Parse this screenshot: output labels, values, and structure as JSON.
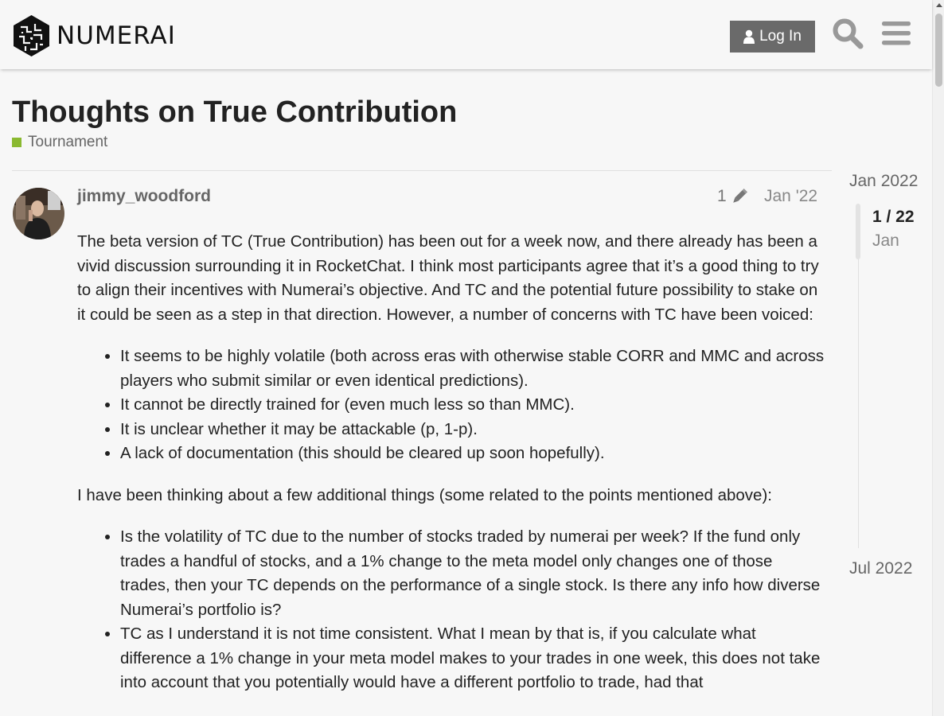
{
  "header": {
    "logo_text": "NUMERAI",
    "login_label": "Log In",
    "icons": {
      "user": "user-icon",
      "search": "search-icon",
      "menu": "hamburger-menu-icon"
    }
  },
  "topic": {
    "title": "Thoughts on True Contribution",
    "category": {
      "name": "Tournament",
      "color": "#8ab930"
    }
  },
  "post": {
    "username": "jimmy_woodford",
    "edit_count": "1",
    "date": "Jan '22",
    "paragraph1": "The beta version of TC (True Contribution) has been out for a week now, and there already has been a vivid discussion surrounding it in RocketChat. I think most participants agree that it’s a good thing to try to align their incentives with Numerai’s objective. And TC and the potential future possibility to stake on it could be seen as a step in that direction. However, a number of concerns with TC have been voiced:",
    "list1": [
      "It seems to be highly volatile (both across eras with otherwise stable CORR and MMC and across players who submit similar or even identical predictions).",
      "It cannot be directly trained for (even much less so than MMC).",
      "It is unclear whether it may be attackable (p, 1-p).",
      "A lack of documentation (this should be cleared up soon hopefully)."
    ],
    "paragraph2": "I have been thinking about a few additional things (some related to the points mentioned above):",
    "list2": [
      "Is the volatility of TC due to the number of stocks traded by numerai per week? If the fund only trades a handful of stocks, and a 1% change to the meta model only changes one of those trades, then your TC depends on the performance of a single stock. Is there any info how diverse Numerai’s portfolio is?",
      "TC as I understand it is not time consistent. What I mean by that is, if you calculate what difference a 1% change in your meta model makes to your trades in one week, this does not take into account that you potentially would have a different portfolio to trade, had that"
    ]
  },
  "timeline": {
    "start": "Jan 2022",
    "position": "1 / 22",
    "month": "Jan",
    "end": "Jul 2022",
    "progress": 0.045
  }
}
